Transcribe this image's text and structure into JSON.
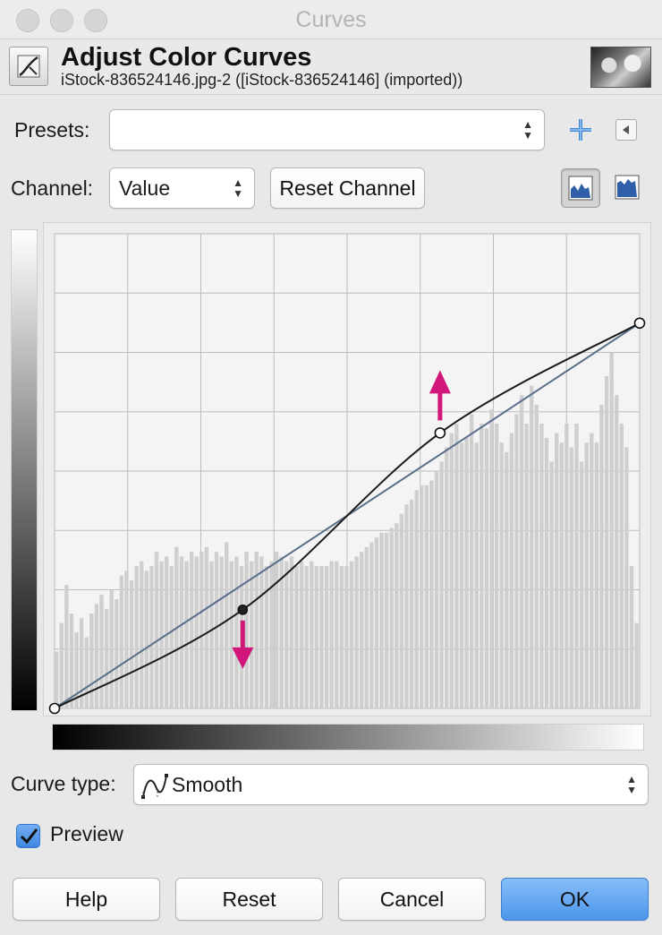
{
  "window": {
    "title": "Curves"
  },
  "header": {
    "title": "Adjust Color Curves",
    "subtitle": "iStock-836524146.jpg-2 ([iStock-836524146] (imported))"
  },
  "presets": {
    "label": "Presets:",
    "value": ""
  },
  "channel": {
    "label": "Channel:",
    "value": "Value",
    "reset_label": "Reset Channel"
  },
  "curve_type": {
    "label": "Curve type:",
    "value": "Smooth"
  },
  "preview": {
    "label": "Preview",
    "checked": true
  },
  "buttons": {
    "help": "Help",
    "reset": "Reset",
    "cancel": "Cancel",
    "ok": "OK"
  },
  "colors": {
    "accent_arrow": "#d1187a",
    "diagonal": "#5a6e8c",
    "curve": "#1a1a1a",
    "histogram": "#cfcfcf",
    "ok_button": "#5aa1ee"
  },
  "curve": {
    "range": [
      0,
      255
    ],
    "control_points": [
      {
        "input": 0,
        "output": 0
      },
      {
        "input": 82,
        "output": 53
      },
      {
        "input": 168,
        "output": 148
      },
      {
        "input": 255,
        "output": 207
      }
    ],
    "selected_point_index": 1,
    "adjustment_hints": [
      {
        "point_index": 1,
        "direction": "down"
      },
      {
        "point_index": 2,
        "direction": "up"
      }
    ]
  },
  "histogram": {
    "bins": [
      0.12,
      0.18,
      0.26,
      0.2,
      0.16,
      0.19,
      0.15,
      0.2,
      0.22,
      0.24,
      0.21,
      0.25,
      0.23,
      0.28,
      0.29,
      0.27,
      0.3,
      0.31,
      0.29,
      0.3,
      0.33,
      0.31,
      0.32,
      0.3,
      0.34,
      0.32,
      0.31,
      0.33,
      0.32,
      0.33,
      0.34,
      0.31,
      0.33,
      0.32,
      0.35,
      0.31,
      0.32,
      0.3,
      0.33,
      0.31,
      0.33,
      0.32,
      0.3,
      0.31,
      0.33,
      0.32,
      0.31,
      0.32,
      0.3,
      0.31,
      0.3,
      0.31,
      0.3,
      0.3,
      0.3,
      0.31,
      0.31,
      0.3,
      0.3,
      0.31,
      0.32,
      0.33,
      0.34,
      0.35,
      0.36,
      0.37,
      0.37,
      0.38,
      0.39,
      0.41,
      0.43,
      0.44,
      0.46,
      0.47,
      0.47,
      0.48,
      0.5,
      0.52,
      0.55,
      0.58,
      0.6,
      0.56,
      0.57,
      0.62,
      0.56,
      0.6,
      0.59,
      0.63,
      0.6,
      0.56,
      0.54,
      0.58,
      0.62,
      0.66,
      0.6,
      0.68,
      0.64,
      0.6,
      0.57,
      0.52,
      0.58,
      0.56,
      0.6,
      0.55,
      0.6,
      0.52,
      0.56,
      0.58,
      0.56,
      0.64,
      0.7,
      0.75,
      0.66,
      0.6,
      0.55,
      0.3,
      0.18
    ]
  }
}
